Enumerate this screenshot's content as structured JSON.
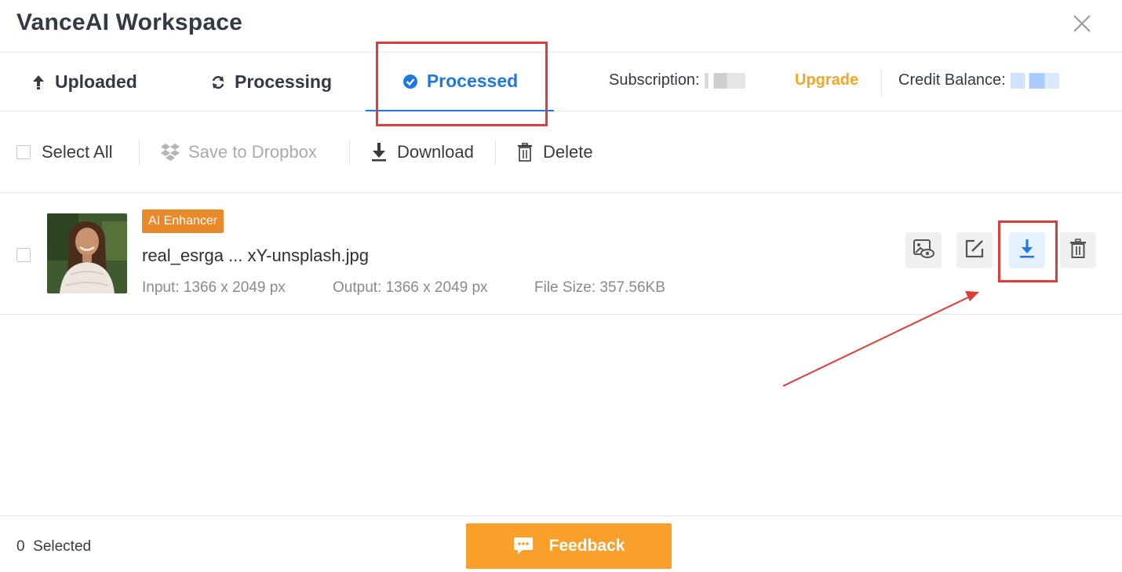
{
  "window": {
    "title": "VanceAI Workspace"
  },
  "tabs": [
    {
      "label": "Uploaded",
      "icon": "upload-arrow-icon"
    },
    {
      "label": "Processing",
      "icon": "refresh-icon"
    },
    {
      "label": "Processed",
      "icon": "check-circle-icon",
      "active": true
    }
  ],
  "account": {
    "subscription_label": "Subscription:",
    "upgrade_label": "Upgrade",
    "credit_label": "Credit Balance:"
  },
  "toolbar": {
    "select_all_label": "Select All",
    "dropbox_label": "Save to Dropbox",
    "download_label": "Download",
    "delete_label": "Delete"
  },
  "files": [
    {
      "badge": "AI Enhancer",
      "name": "real_esrga ... xY-unsplash.jpg",
      "input": "Input: 1366 x 2049 px",
      "output": "Output: 1366 x 2049 px",
      "size": "File Size: 357.56KB",
      "actions": [
        "preview-icon",
        "edit-icon",
        "download-icon",
        "trash-icon"
      ]
    }
  ],
  "footer": {
    "selected_count": "0",
    "selected_label": "Selected",
    "feedback_label": "Feedback"
  },
  "colors": {
    "accent_blue": "#1f77e3",
    "upgrade_orange": "#f5a623",
    "badge_orange": "#e8892b",
    "feedback_orange": "#f9a02a",
    "annotation_red": "#e03b3b"
  }
}
